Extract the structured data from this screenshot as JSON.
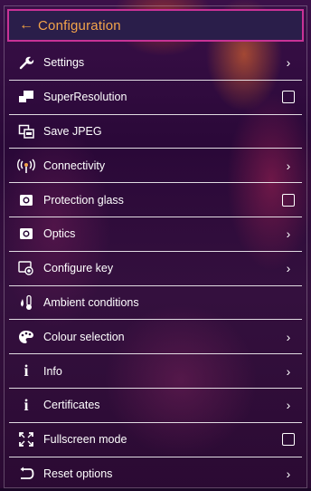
{
  "header": {
    "title": "Configuration",
    "back_icon": "arrow-left-icon"
  },
  "menu": {
    "items": [
      {
        "label": "Settings",
        "icon": "wrench-icon",
        "control": "chevron"
      },
      {
        "label": "SuperResolution",
        "icon": "superresolution-icon",
        "control": "checkbox",
        "checked": false
      },
      {
        "label": "Save JPEG",
        "icon": "save-jpeg-icon",
        "control": "none"
      },
      {
        "label": "Connectivity",
        "icon": "wireless-icon",
        "control": "chevron"
      },
      {
        "label": "Protection glass",
        "icon": "camera-icon",
        "control": "checkbox",
        "checked": false
      },
      {
        "label": "Optics",
        "icon": "lens-icon",
        "control": "chevron"
      },
      {
        "label": "Configure key",
        "icon": "key-button-icon",
        "control": "chevron"
      },
      {
        "label": "Ambient conditions",
        "icon": "thermometer-icon",
        "control": "none"
      },
      {
        "label": "Colour selection",
        "icon": "palette-icon",
        "control": "chevron"
      },
      {
        "label": "Info",
        "icon": "info-icon",
        "control": "chevron"
      },
      {
        "label": "Certificates",
        "icon": "info-icon",
        "control": "chevron"
      },
      {
        "label": "Fullscreen mode",
        "icon": "fullscreen-icon",
        "control": "checkbox",
        "checked": false
      },
      {
        "label": "Reset options",
        "icon": "reset-icon",
        "control": "chevron"
      }
    ]
  },
  "colors": {
    "header_text": "#f3a44a",
    "header_border": "#c83296",
    "header_bg": "#2a1e4a"
  }
}
